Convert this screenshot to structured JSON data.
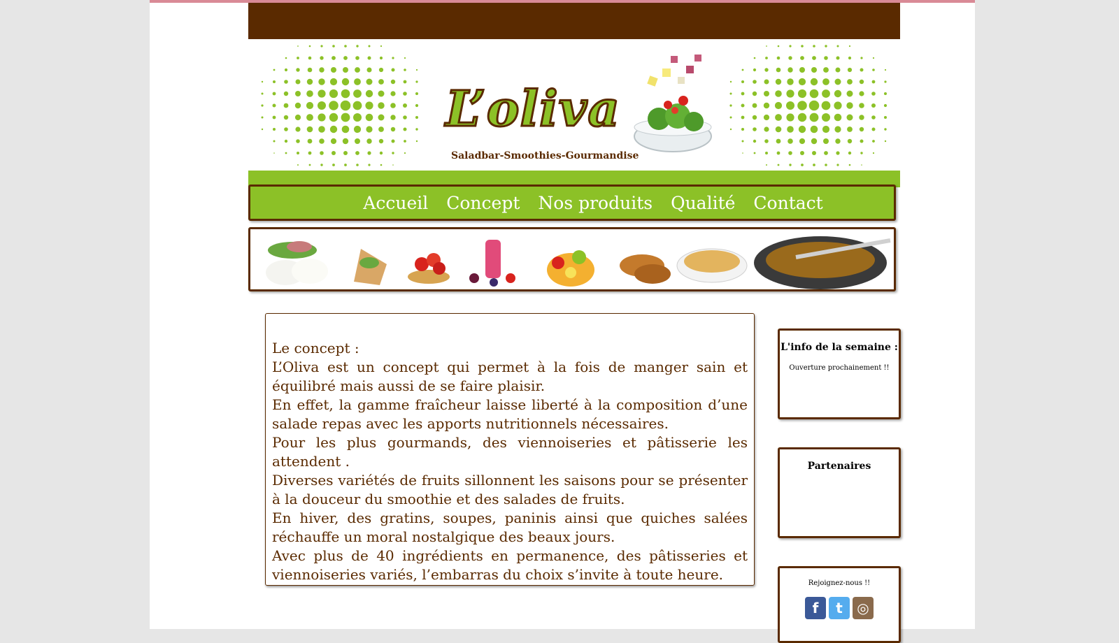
{
  "brand": {
    "name": "L’oliva",
    "tagline": "Saladbar-Smoothies-Gourmandise"
  },
  "nav": {
    "items": [
      "Accueil",
      "Concept",
      "Nos produits",
      "Qualité",
      "Contact"
    ]
  },
  "main": {
    "lines": [
      "Le concept :",
      "L’Oliva est un concept qui permet à la fois de manger sain et équilibré mais aussi de se faire plaisir.",
      "En effet, la gamme fraîcheur laisse liberté à la composition d’une salade repas avec les apports nutritionnels nécessaires.",
      "Pour les plus gourmands, des viennoiseries et pâtisserie les attendent .",
      "Diverses variétés de fruits sillonnent les saisons pour se présenter à la douceur du smoothie et des salades de fruits.",
      "En hiver, des gratins, soupes, paninis ainsi que quiches salées réchauffe un moral nostalgique des beaux jours.",
      "Avec plus de 40 ingrédients en permanence, des pâtisseries et viennoiseries variés, l’embarras du choix s’invite à toute heure."
    ]
  },
  "sidebar": {
    "info_title": "L'info de la semaine :",
    "info_text": "Ouverture prochainement !!",
    "partners_title": "Partenaires",
    "join_text": "Rejoignez-nous !!",
    "social_icons": [
      "facebook-icon",
      "twitter-icon",
      "instagram-icon"
    ]
  },
  "colors": {
    "brown": "#5a2a00",
    "green": "#8cc127",
    "topstrip": "#d98a96"
  }
}
